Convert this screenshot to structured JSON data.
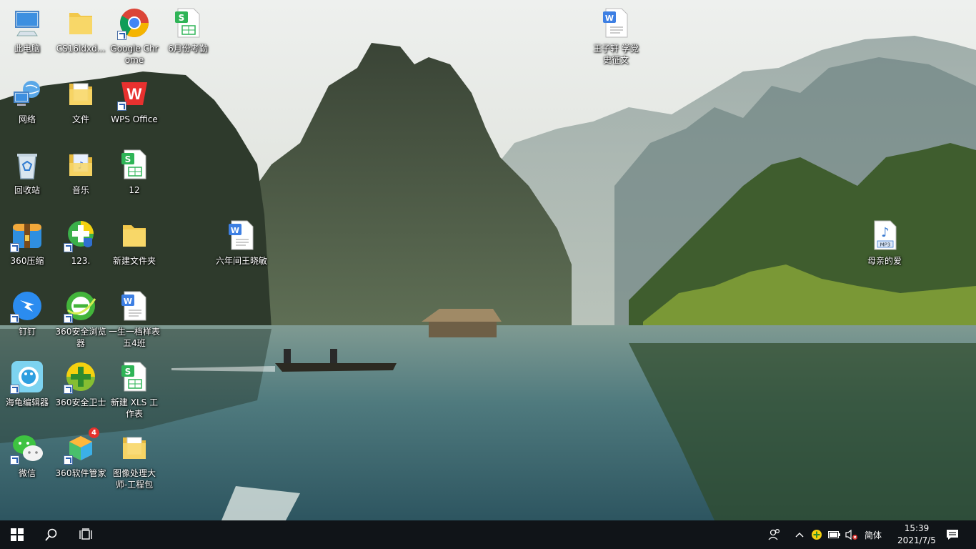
{
  "desktop": {
    "icons": [
      {
        "id": "this-pc",
        "label": "此电脑",
        "icon": "computer-icon",
        "shortcut": false
      },
      {
        "id": "cs16",
        "label": "CS16ldxd...",
        "icon": "folder-icon",
        "shortcut": false
      },
      {
        "id": "chrome",
        "label": "Google Chrome",
        "icon": "chrome-icon",
        "shortcut": true
      },
      {
        "id": "june-attendance",
        "label": "6月份考勤",
        "icon": "spreadsheet-icon",
        "shortcut": false
      },
      {
        "id": "network",
        "label": "网络",
        "icon": "network-icon",
        "shortcut": false
      },
      {
        "id": "files",
        "label": "文件",
        "icon": "folder-doc-icon",
        "shortcut": false
      },
      {
        "id": "wps",
        "label": "WPS Office",
        "icon": "wps-icon",
        "shortcut": true
      },
      {
        "id": "recycle-bin",
        "label": "回收站",
        "icon": "recycle-bin-icon",
        "shortcut": false
      },
      {
        "id": "music",
        "label": "音乐",
        "icon": "folder-music-icon",
        "shortcut": false
      },
      {
        "id": "file-12",
        "label": "12",
        "icon": "spreadsheet-icon",
        "shortcut": false
      },
      {
        "id": "zip360",
        "label": "360压缩",
        "icon": "archive-icon",
        "shortcut": true
      },
      {
        "id": "app123",
        "label": "123.",
        "icon": "shield-plus-icon",
        "shortcut": true
      },
      {
        "id": "new-folder",
        "label": "新建文件夹",
        "icon": "folder-icon",
        "shortcut": false
      },
      {
        "id": "dingtalk",
        "label": "钉钉",
        "icon": "dingtalk-icon",
        "shortcut": true
      },
      {
        "id": "browser360",
        "label": "360安全浏览器",
        "icon": "browser-360-icon",
        "shortcut": true
      },
      {
        "id": "resume",
        "label": "一生一档样表五4班",
        "icon": "word-doc-icon",
        "shortcut": false
      },
      {
        "id": "haigui",
        "label": "海龟编辑器",
        "icon": "turtle-editor-icon",
        "shortcut": true
      },
      {
        "id": "guard360",
        "label": "360安全卫士",
        "icon": "guard-360-icon",
        "shortcut": true
      },
      {
        "id": "new-xls",
        "label": "新建 XLS 工作表",
        "icon": "spreadsheet-icon",
        "shortcut": false
      },
      {
        "id": "wechat",
        "label": "微信",
        "icon": "wechat-icon",
        "shortcut": true
      },
      {
        "id": "softmgr360",
        "label": "360软件管家",
        "icon": "software-manager-icon",
        "shortcut": true,
        "badge": "4"
      },
      {
        "id": "image-master",
        "label": "图像处理大师-工程包",
        "icon": "folder-doc-icon",
        "shortcut": false
      },
      {
        "id": "six-grade",
        "label": "六年间王晓敏",
        "icon": "word-doc-icon",
        "shortcut": false
      },
      {
        "id": "wang-essay",
        "label": "王子轩 学党史征文",
        "icon": "word-doc-icon",
        "shortcut": false
      },
      {
        "id": "mother-love",
        "label": "母亲的爱",
        "icon": "mp3-file-icon",
        "shortcut": false,
        "file_text": "MP3"
      }
    ]
  },
  "taskbar": {
    "ime": "简体",
    "time": "15:39",
    "date": "2021/7/5"
  }
}
